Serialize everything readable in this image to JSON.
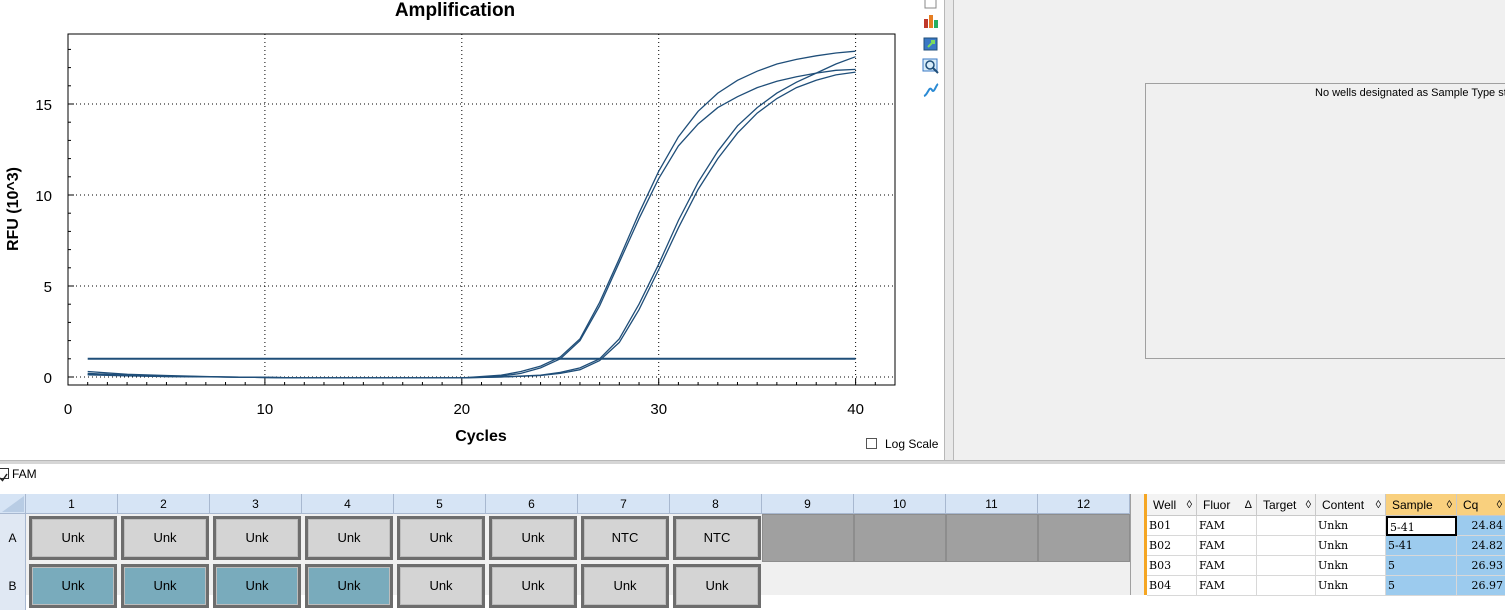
{
  "chart_data": {
    "type": "line",
    "title": "Amplification",
    "xlabel": "Cycles",
    "ylabel": "RFU (10^3)",
    "xlim": [
      0,
      42
    ],
    "ylim": [
      -0.5,
      18.5
    ],
    "xticks": [
      0,
      10,
      20,
      30,
      40
    ],
    "yticks": [
      0,
      5,
      10,
      15
    ],
    "grid": true,
    "line_color": "#1f4e79",
    "threshold": 1.0,
    "series": [
      {
        "x": [
          1,
          3,
          5,
          8,
          12,
          16,
          20,
          22,
          23,
          24,
          25,
          26,
          27,
          28,
          29,
          30,
          31,
          32,
          33,
          34,
          35,
          36,
          37,
          38,
          39,
          40
        ],
        "y": [
          0.2,
          0.1,
          0.05,
          0,
          -0.05,
          -0.05,
          -0.05,
          0.1,
          0.3,
          0.6,
          1.1,
          2.1,
          4.1,
          6.5,
          9.0,
          11.3,
          13.2,
          14.6,
          15.6,
          16.3,
          16.8,
          17.2,
          17.45,
          17.65,
          17.8,
          17.9
        ]
      },
      {
        "x": [
          1,
          3,
          5,
          8,
          12,
          16,
          20,
          22,
          23,
          24,
          25,
          26,
          27,
          28,
          29,
          30,
          31,
          32,
          33,
          34,
          35,
          36,
          37,
          38,
          39,
          40
        ],
        "y": [
          0.3,
          0.15,
          0.08,
          0,
          -0.05,
          -0.05,
          -0.05,
          0.05,
          0.2,
          0.5,
          1.0,
          2.0,
          3.9,
          6.3,
          8.7,
          10.9,
          12.7,
          13.9,
          14.8,
          15.4,
          15.9,
          16.25,
          16.5,
          16.7,
          16.85,
          16.9
        ]
      },
      {
        "x": [
          1,
          3,
          5,
          8,
          12,
          16,
          20,
          22,
          24,
          25,
          26,
          27,
          28,
          29,
          30,
          31,
          32,
          33,
          34,
          35,
          36,
          37,
          38,
          39,
          40
        ],
        "y": [
          0.15,
          0.08,
          0.03,
          0,
          -0.05,
          -0.05,
          -0.05,
          0,
          0.1,
          0.25,
          0.5,
          1.0,
          2.1,
          4.0,
          6.2,
          8.6,
          10.7,
          12.4,
          13.8,
          14.8,
          15.6,
          16.2,
          16.7,
          17.2,
          17.6
        ]
      },
      {
        "x": [
          1,
          3,
          5,
          8,
          12,
          16,
          20,
          22,
          24,
          25,
          26,
          27,
          28,
          29,
          30,
          31,
          32,
          33,
          34,
          35,
          36,
          37,
          38,
          39,
          40
        ],
        "y": [
          0.12,
          0.06,
          0.02,
          0,
          -0.05,
          -0.05,
          -0.05,
          0,
          0.08,
          0.2,
          0.4,
          0.9,
          1.9,
          3.7,
          5.9,
          8.2,
          10.3,
          12.0,
          13.4,
          14.5,
          15.3,
          15.9,
          16.3,
          16.6,
          16.75
        ]
      }
    ]
  },
  "log_scale_label": "Log Scale",
  "std_curve_message": "No wells designated as Sample Type sta",
  "fluor_label": "FAM",
  "plate": {
    "columns": [
      "1",
      "2",
      "3",
      "4",
      "5",
      "6",
      "7",
      "8",
      "9",
      "10",
      "11",
      "12"
    ],
    "rows": [
      "A",
      "B"
    ],
    "row_a": [
      "Unk",
      "Unk",
      "Unk",
      "Unk",
      "Unk",
      "Unk",
      "NTC",
      "NTC",
      "",
      "",
      "",
      ""
    ],
    "row_b": [
      "Unk",
      "Unk",
      "Unk",
      "Unk",
      "Unk",
      "Unk",
      "Unk",
      "Unk"
    ]
  },
  "table": {
    "headers": [
      "Well",
      "Fluor",
      "Target",
      "Content",
      "Sample",
      "Cq"
    ],
    "sort_glyphs": [
      "◊",
      "Δ",
      "◊",
      "◊",
      "◊",
      "◊"
    ],
    "rows": [
      {
        "well": "B01",
        "fluor": "FAM",
        "target": "",
        "content": "Unkn",
        "sample": "5-41",
        "cq": "24.84"
      },
      {
        "well": "B02",
        "fluor": "FAM",
        "target": "",
        "content": "Unkn",
        "sample": "5-41",
        "cq": "24.82"
      },
      {
        "well": "B03",
        "fluor": "FAM",
        "target": "",
        "content": "Unkn",
        "sample": "5",
        "cq": "26.93"
      },
      {
        "well": "B04",
        "fluor": "FAM",
        "target": "",
        "content": "Unkn",
        "sample": "5",
        "cq": "26.97"
      }
    ]
  },
  "toolbar_icons": [
    "copy-icon",
    "chart-settings-icon",
    "export-icon",
    "zoom-icon",
    "curve-fit-icon"
  ]
}
